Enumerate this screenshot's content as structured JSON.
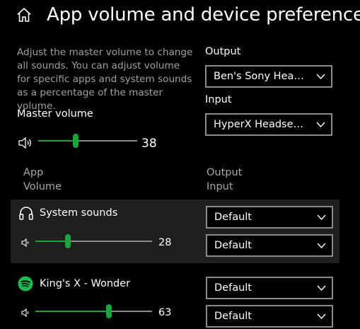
{
  "header": {
    "title": "App volume and device preferences",
    "home_icon": "home-icon"
  },
  "description": "Adjust the master volume to change all sounds. You can adjust volume for specific apps and system sounds as a percentage of the master volume.",
  "master": {
    "label": "Master volume",
    "value": "38",
    "level": 0.38,
    "icon": "speaker-icon"
  },
  "output": {
    "label": "Output",
    "selected": "Ben's Sony Headphones"
  },
  "input": {
    "label": "Input",
    "selected": "HyperX Headset Mic"
  },
  "columns": {
    "app_line1": "App",
    "app_line2": "Volume",
    "device_line1": "Output",
    "device_line2": "Input"
  },
  "apps": [
    {
      "name": "System sounds",
      "icon": "headphones-icon",
      "volume": "28",
      "level": 0.28,
      "output": "Default",
      "input": "Default"
    },
    {
      "name": "King's X - Wonder",
      "icon": "spotify-icon",
      "volume": "63",
      "level": 0.63,
      "output": "Default",
      "input": "Default"
    }
  ],
  "colors": {
    "accent": "#18a53a",
    "background": "#000000",
    "selected_row": "#1f1f1f",
    "spotify": "#1db954"
  }
}
